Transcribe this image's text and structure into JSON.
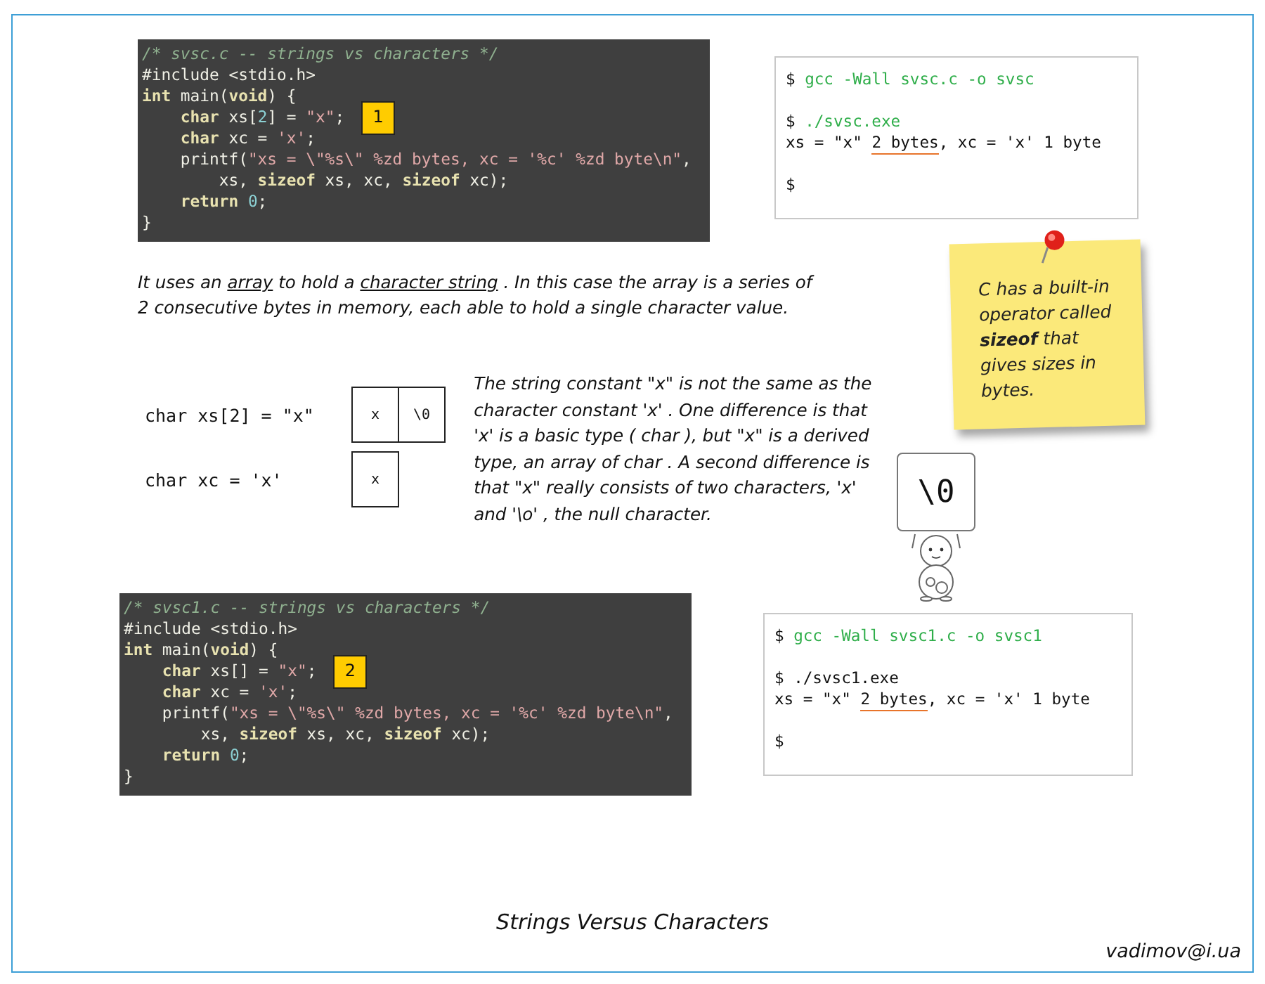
{
  "code_blocks": [
    {
      "lines": [
        {
          "tokens": [
            {
              "kind": "comment",
              "t": "/* svsc.c -- strings vs characters */"
            }
          ]
        },
        {
          "tokens": [
            {
              "kind": "plain",
              "t": "#include <stdio.h>"
            }
          ]
        },
        {
          "tokens": [
            {
              "kind": "keyword",
              "t": "int"
            },
            {
              "kind": "plain",
              "t": " main("
            },
            {
              "kind": "keyword",
              "t": "void"
            },
            {
              "kind": "plain",
              "t": ") {"
            }
          ]
        },
        {
          "tokens": [
            {
              "kind": "keyword",
              "t": "    char"
            },
            {
              "kind": "plain",
              "t": " xs["
            },
            {
              "kind": "number",
              "t": "2"
            },
            {
              "kind": "plain",
              "t": "] = "
            },
            {
              "kind": "string",
              "t": "\"x\""
            },
            {
              "kind": "plain",
              "t": ";"
            }
          ],
          "badge": "1"
        },
        {
          "tokens": [
            {
              "kind": "keyword",
              "t": "    char"
            },
            {
              "kind": "plain",
              "t": " xc = "
            },
            {
              "kind": "string",
              "t": "'x'"
            },
            {
              "kind": "plain",
              "t": ";"
            }
          ]
        },
        {
          "tokens": [
            {
              "kind": "plain",
              "t": "    printf("
            },
            {
              "kind": "string",
              "t": "\"xs = \\\"%s\\\" %zd bytes, xc = '%c' %zd byte\\n\""
            },
            {
              "kind": "plain",
              "t": ","
            }
          ]
        },
        {
          "tokens": [
            {
              "kind": "plain",
              "t": "        xs, "
            },
            {
              "kind": "keyword",
              "t": "sizeof"
            },
            {
              "kind": "plain",
              "t": " xs, xc, "
            },
            {
              "kind": "keyword",
              "t": "sizeof"
            },
            {
              "kind": "plain",
              "t": " xc);"
            }
          ]
        },
        {
          "tokens": [
            {
              "kind": "keyword",
              "t": "    return "
            },
            {
              "kind": "number",
              "t": "0"
            },
            {
              "kind": "plain",
              "t": ";"
            }
          ]
        },
        {
          "tokens": [
            {
              "kind": "plain",
              "t": "}"
            }
          ]
        }
      ]
    },
    {
      "lines": [
        {
          "tokens": [
            {
              "kind": "comment",
              "t": "/* svsc1.c -- strings vs characters */"
            }
          ]
        },
        {
          "tokens": [
            {
              "kind": "plain",
              "t": "#include <stdio.h>"
            }
          ]
        },
        {
          "tokens": [
            {
              "kind": "keyword",
              "t": "int"
            },
            {
              "kind": "plain",
              "t": " main("
            },
            {
              "kind": "keyword",
              "t": "void"
            },
            {
              "kind": "plain",
              "t": ") {"
            }
          ]
        },
        {
          "tokens": [
            {
              "kind": "keyword",
              "t": "    char"
            },
            {
              "kind": "plain",
              "t": " xs[] = "
            },
            {
              "kind": "string",
              "t": "\"x\""
            },
            {
              "kind": "plain",
              "t": ";"
            }
          ],
          "badge": "2"
        },
        {
          "tokens": [
            {
              "kind": "keyword",
              "t": "    char"
            },
            {
              "kind": "plain",
              "t": " xc = "
            },
            {
              "kind": "string",
              "t": "'x'"
            },
            {
              "kind": "plain",
              "t": ";"
            }
          ]
        },
        {
          "tokens": [
            {
              "kind": "plain",
              "t": "    printf("
            },
            {
              "kind": "string",
              "t": "\"xs = \\\"%s\\\" %zd bytes, xc = '%c' %zd byte\\n\""
            },
            {
              "kind": "plain",
              "t": ","
            }
          ]
        },
        {
          "tokens": [
            {
              "kind": "plain",
              "t": "        xs, "
            },
            {
              "kind": "keyword",
              "t": "sizeof"
            },
            {
              "kind": "plain",
              "t": " xs, xc, "
            },
            {
              "kind": "keyword",
              "t": "sizeof"
            },
            {
              "kind": "plain",
              "t": " xc);"
            }
          ]
        },
        {
          "tokens": [
            {
              "kind": "keyword",
              "t": "    return "
            },
            {
              "kind": "number",
              "t": "0"
            },
            {
              "kind": "plain",
              "t": ";"
            }
          ]
        },
        {
          "tokens": [
            {
              "kind": "plain",
              "t": "}"
            }
          ]
        }
      ]
    }
  ],
  "terminals": [
    {
      "blocks": [
        [
          {
            "segments": [
              {
                "kind": "prompt",
                "text": "$"
              },
              {
                "kind": "command",
                "text": "gcc -Wall svsc.c -o svsc"
              }
            ]
          }
        ],
        [
          {
            "segments": [
              {
                "kind": "prompt",
                "text": "$"
              },
              {
                "kind": "command",
                "text": "./svsc.exe"
              }
            ]
          },
          {
            "segments": [
              {
                "kind": "output",
                "text": "xs = \"x\" "
              },
              {
                "kind": "output",
                "text": "2 bytes",
                "underlined": true
              },
              {
                "kind": "output",
                "text": ", xc = 'x' 1 byte"
              }
            ]
          }
        ],
        [
          {
            "segments": [
              {
                "kind": "prompt",
                "text": "$"
              }
            ]
          }
        ]
      ]
    },
    {
      "blocks": [
        [
          {
            "segments": [
              {
                "kind": "prompt",
                "text": "$"
              },
              {
                "kind": "command",
                "text": "gcc -Wall svsc1.c -o svsc1"
              }
            ]
          }
        ],
        [
          {
            "segments": [
              {
                "kind": "prompt",
                "text": "$"
              },
              {
                "kind": "output",
                "text": "./svsc1.exe"
              }
            ]
          },
          {
            "segments": [
              {
                "kind": "output",
                "text": "xs = \"x\" "
              },
              {
                "kind": "output",
                "text": "2 bytes",
                "underlined": true
              },
              {
                "kind": "output",
                "text": ", xc = 'x' 1 byte"
              }
            ]
          }
        ],
        [
          {
            "segments": [
              {
                "kind": "prompt",
                "text": "$"
              }
            ]
          }
        ]
      ]
    }
  ],
  "intro": [
    {
      "text": "It uses an "
    },
    {
      "text": "array",
      "underlined": true
    },
    {
      "text": " to hold a "
    },
    {
      "text": "character string",
      "underlined": true
    },
    {
      "text": " . In this case the array  is a series of 2 consecutive bytes in memory, each able to hold a single character value."
    }
  ],
  "memory_diagram": [
    {
      "declaration": "char xs[2] = \"x\"",
      "cells": [
        "x",
        "\\0"
      ]
    },
    {
      "declaration": "char xc = 'x'",
      "cells": [
        "x"
      ]
    }
  ],
  "explanation": "The string constant \"x\" is not the same as the character constant 'x' . One difference is that 'x' is a basic type ( char ), but \"x\" is a derived type, an array of char . A second difference is that \"x\" really consists of two characters, 'x' and '\\o' , the null character.",
  "sticky_note": "C has a built-in operator called **sizeof** that gives sizes in bytes.",
  "mascot_sign": "\\0",
  "title": "Strings Versus Characters",
  "footer": "vadimov@i.ua"
}
